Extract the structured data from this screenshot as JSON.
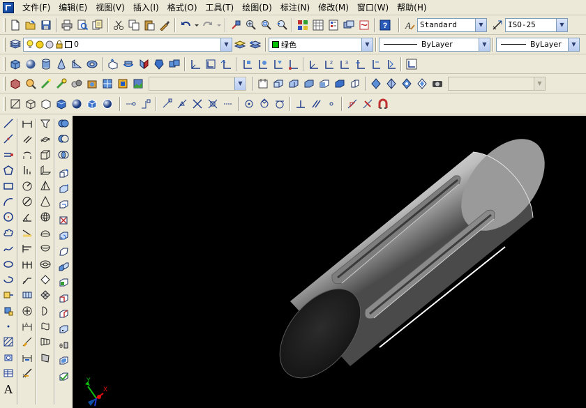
{
  "menu": {
    "items": [
      "文件(F)",
      "编辑(E)",
      "视图(V)",
      "插入(I)",
      "格式(O)",
      "工具(T)",
      "绘图(D)",
      "标注(N)",
      "修改(M)",
      "窗口(W)",
      "帮助(H)"
    ]
  },
  "styles": {
    "text_style": "Standard",
    "dim_style": "ISO-25"
  },
  "layers": {
    "current_layer": "0"
  },
  "properties": {
    "color": "绿色",
    "color_swatch": "#00c000",
    "linetype": "ByLayer",
    "lineweight": "ByLayer"
  },
  "render": {
    "material": ""
  },
  "side_tools": {
    "text_tool_label": "A"
  },
  "ucs": {
    "x_label": "X",
    "y_label": "Y"
  },
  "colors": {
    "background": "#ece9d8",
    "drawing_background": "#000000",
    "accent_blue": "#1c5bc4",
    "ucs_red": "#e01010",
    "ucs_green": "#10c010",
    "ucs_blue": "#2040e0"
  }
}
